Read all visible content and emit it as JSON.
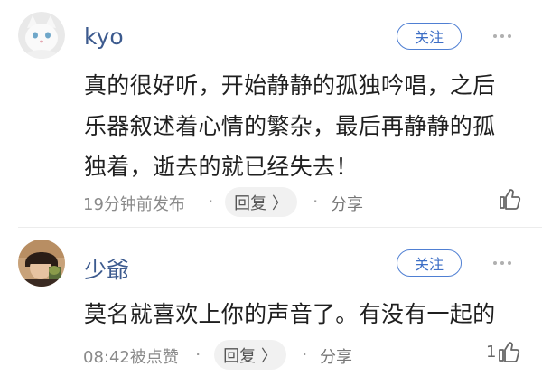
{
  "comments": [
    {
      "username": "kyo",
      "follow_label": "关注",
      "text": "真的很好听，开始静静的孤独吟唱，之后乐器叙述着心情的繁杂，最后再静静的孤独着，逝去的就已经失去！",
      "time": "19分钟前发布",
      "separator": "·",
      "reply_label": "回复 〉",
      "share_label": "分享",
      "like_count": ""
    },
    {
      "username": "少爺",
      "follow_label": "关注",
      "text": "莫名就喜欢上你的声音了。有没有一起的",
      "time": "08:42被点赞",
      "separator": "·",
      "reply_label": "回复 〉",
      "share_label": "分享",
      "like_count": "1"
    }
  ],
  "colors": {
    "username": "#3c5a8e",
    "follow_border": "#4f7fd3",
    "meta": "#8a8a8a"
  }
}
